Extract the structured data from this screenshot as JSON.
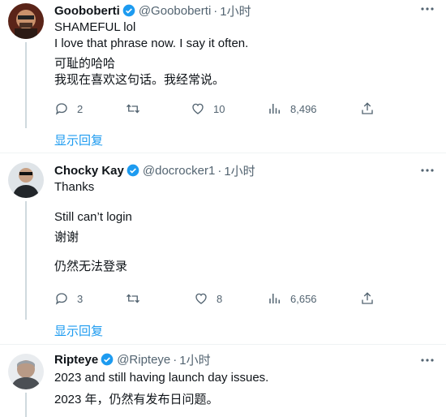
{
  "tweets": [
    {
      "name": "Gooboberti",
      "handle": "@Gooboberti",
      "time": "1小时",
      "lines": [
        "SHAMEFUL lol",
        "I love that phrase now. I say it often.",
        "可耻的哈哈",
        "我现在喜欢这句话。我经常说。"
      ],
      "replies": "2",
      "retweets": "",
      "likes": "10",
      "views": "8,496",
      "show_replies": "显示回复",
      "avatar_color": "#7a2e1e"
    },
    {
      "name": "Chocky Kay",
      "handle": "@docrocker1",
      "time": "1小时",
      "lines": [
        "Thanks",
        "Still can’t login",
        "谢谢",
        "仍然无法登录"
      ],
      "replies": "3",
      "retweets": "",
      "likes": "8",
      "views": "6,656",
      "show_replies": "显示回复",
      "avatar_color": "#3a3f44"
    },
    {
      "name": "Ripteye",
      "handle": "@Ripteye",
      "time": "1小时",
      "lines": [
        "2023 and still having launch day issues.",
        "2023 年，仍然有发布日问题。"
      ],
      "avatar_color": "#8a8f94"
    }
  ],
  "colors": {
    "accent": "#1d9bf0",
    "muted": "#536471",
    "verified": "#1d9bf0"
  },
  "icons": [
    "verified-badge-icon",
    "more-icon",
    "reply-icon",
    "retweet-icon",
    "like-icon",
    "views-icon",
    "share-icon"
  ]
}
